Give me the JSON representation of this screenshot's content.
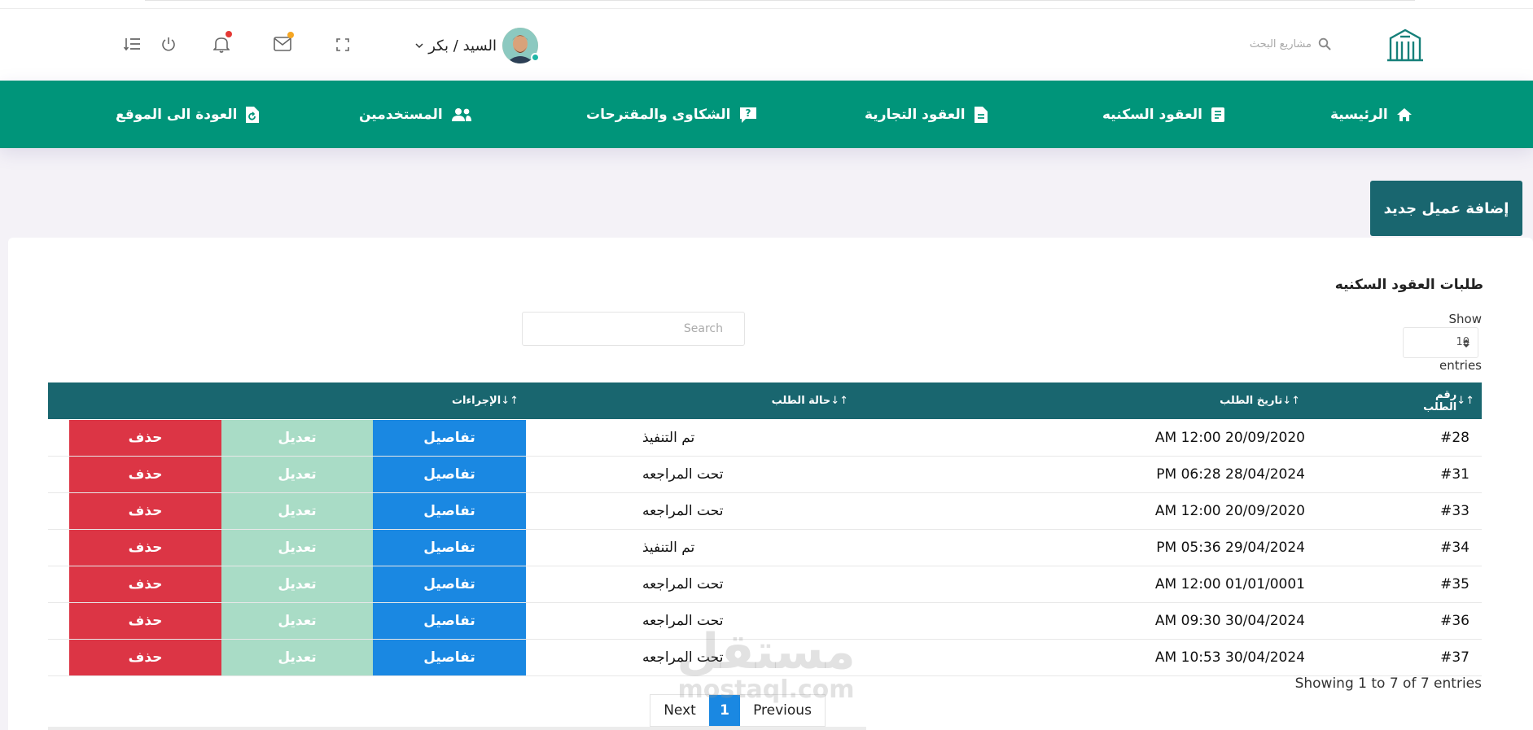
{
  "header": {
    "search_placeholder": "مشاريع البحث",
    "user_name": "السيد / بكر"
  },
  "nav": {
    "items": [
      {
        "label": "الرئيسية"
      },
      {
        "label": "العقود السكنيه"
      },
      {
        "label": "العقود التجارية"
      },
      {
        "label": "الشكاوى والمقترحات"
      },
      {
        "label": "المستخدمين"
      },
      {
        "label": "العودة الى الموقع"
      }
    ]
  },
  "actions": {
    "add_client_label": "إضافة عميل جديد"
  },
  "table_card": {
    "title": "طلبات العقود السكنيه",
    "show_label": "Show",
    "entries_label": "entries",
    "page_length": "10",
    "search_placeholder": "Search",
    "columns": [
      {
        "label": "رقم الطلب"
      },
      {
        "label": "تاريخ الطلب"
      },
      {
        "label": "حالة الطلب"
      },
      {
        "label": "الإجراءات"
      }
    ],
    "rows": [
      {
        "id": "#28",
        "date": "AM 12:00 20/09/2020",
        "status": "تم التنفيذ",
        "details": "تفاصيل",
        "edit": "تعديل",
        "delete": "حذف"
      },
      {
        "id": "#31",
        "date": "PM 06:28 28/04/2024",
        "status": "تحت المراجعه",
        "details": "تفاصيل",
        "edit": "تعديل",
        "delete": "حذف"
      },
      {
        "id": "#33",
        "date": "AM 12:00 20/09/2020",
        "status": "تحت المراجعه",
        "details": "تفاصيل",
        "edit": "تعديل",
        "delete": "حذف"
      },
      {
        "id": "#34",
        "date": "PM 05:36 29/04/2024",
        "status": "تم التنفيذ",
        "details": "تفاصيل",
        "edit": "تعديل",
        "delete": "حذف"
      },
      {
        "id": "#35",
        "date": "AM 12:00 01/01/0001",
        "status": "تحت المراجعه",
        "details": "تفاصيل",
        "edit": "تعديل",
        "delete": "حذف"
      },
      {
        "id": "#36",
        "date": "AM 09:30 30/04/2024",
        "status": "تحت المراجعه",
        "details": "تفاصيل",
        "edit": "تعديل",
        "delete": "حذف"
      },
      {
        "id": "#37",
        "date": "AM 10:53 30/04/2024",
        "status": "تحت المراجعه",
        "details": "تفاصيل",
        "edit": "تعديل",
        "delete": "حذف"
      }
    ],
    "info": "Showing 1 to 7 of 7 entries",
    "pagination": {
      "next": "Next",
      "current": "1",
      "previous": "Previous"
    }
  },
  "watermark": {
    "line1": "مستقل",
    "line2": "mostaql.com"
  },
  "colors": {
    "primary_green": "#00957a",
    "dark_teal": "#19666f",
    "details_blue": "#1a88e2",
    "edit_mint": "#a9dcc6",
    "delete_red": "#dc3545",
    "notification_red": "#e53935",
    "mail_orange": "#f5a623"
  },
  "icons": {
    "logo": "building-logo-icon",
    "search": "search-icon",
    "avatar": "user-avatar",
    "fullscreen": "fullscreen-icon",
    "mail": "mail-icon",
    "bell": "bell-icon",
    "power": "power-icon",
    "menu": "sort-menu-icon"
  }
}
